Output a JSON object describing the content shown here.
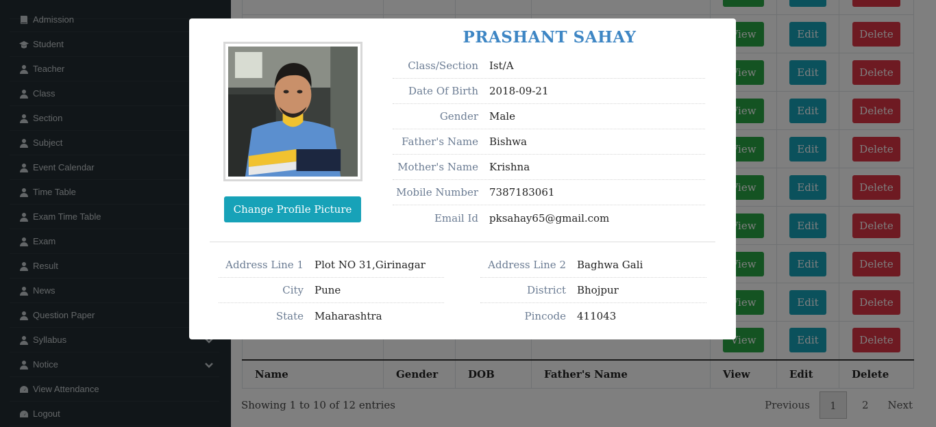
{
  "sidebar": {
    "items": [
      {
        "label": "Admission",
        "icon": "book-icon"
      },
      {
        "label": "Student",
        "icon": "graduation-cap-icon"
      },
      {
        "label": "Teacher",
        "icon": "user-icon"
      },
      {
        "label": "Class",
        "icon": "user-icon"
      },
      {
        "label": "Section",
        "icon": "user-icon"
      },
      {
        "label": "Subject",
        "icon": "user-icon"
      },
      {
        "label": "Event Calendar",
        "icon": "user-icon"
      },
      {
        "label": "Time Table",
        "icon": "user-icon"
      },
      {
        "label": "Exam Time Table",
        "icon": "user-icon"
      },
      {
        "label": "Exam",
        "icon": "user-icon"
      },
      {
        "label": "Result",
        "icon": "user-icon"
      },
      {
        "label": "News",
        "icon": "user-icon"
      },
      {
        "label": "Question Paper",
        "icon": "user-icon"
      },
      {
        "label": "Syllabus",
        "icon": "user-icon"
      },
      {
        "label": "Notice",
        "icon": "user-icon"
      },
      {
        "label": "View Attendance",
        "icon": "tachometer-icon"
      },
      {
        "label": "Logout",
        "icon": "tachometer-icon"
      }
    ]
  },
  "table": {
    "headers": [
      "Name",
      "Gender",
      "DOB",
      "Father's Name",
      "View",
      "Edit",
      "Delete"
    ],
    "view_label": "View",
    "edit_label": "Edit",
    "delete_label": "Delete",
    "showing": "Showing 1 to 10 of 12 entries",
    "pagination": {
      "previous": "Previous",
      "pages": [
        "1",
        "2"
      ],
      "active": "1",
      "next": "Next"
    }
  },
  "modal": {
    "name": "PRASHANT SAHAY",
    "change_picture_label": "Change Profile Picture",
    "details": [
      {
        "label": "Class/Section",
        "value": "Ist/A"
      },
      {
        "label": "Date Of Birth",
        "value": "2018-09-21"
      },
      {
        "label": "Gender",
        "value": "Male"
      },
      {
        "label": "Father's Name",
        "value": "Bishwa"
      },
      {
        "label": "Mother's Name",
        "value": "Krishna"
      },
      {
        "label": "Mobile Number",
        "value": "7387183061"
      },
      {
        "label": "Email Id",
        "value": "pksahay65@gmail.com"
      }
    ],
    "address_left": [
      {
        "label": "Address Line 1",
        "value": "Plot NO 31,Girinagar"
      },
      {
        "label": "City",
        "value": "Pune"
      },
      {
        "label": "State",
        "value": "Maharashtra"
      }
    ],
    "address_right": [
      {
        "label": "Address Line 2",
        "value": "Baghwa Gali"
      },
      {
        "label": "District",
        "value": "Bhojpur"
      },
      {
        "label": "Pincode",
        "value": "411043"
      }
    ]
  },
  "colors": {
    "sidebar_bg": "#222d32",
    "accent_name": "#3e86c4",
    "view": "#28a745",
    "edit": "#17a2b8",
    "delete": "#dc3545"
  }
}
